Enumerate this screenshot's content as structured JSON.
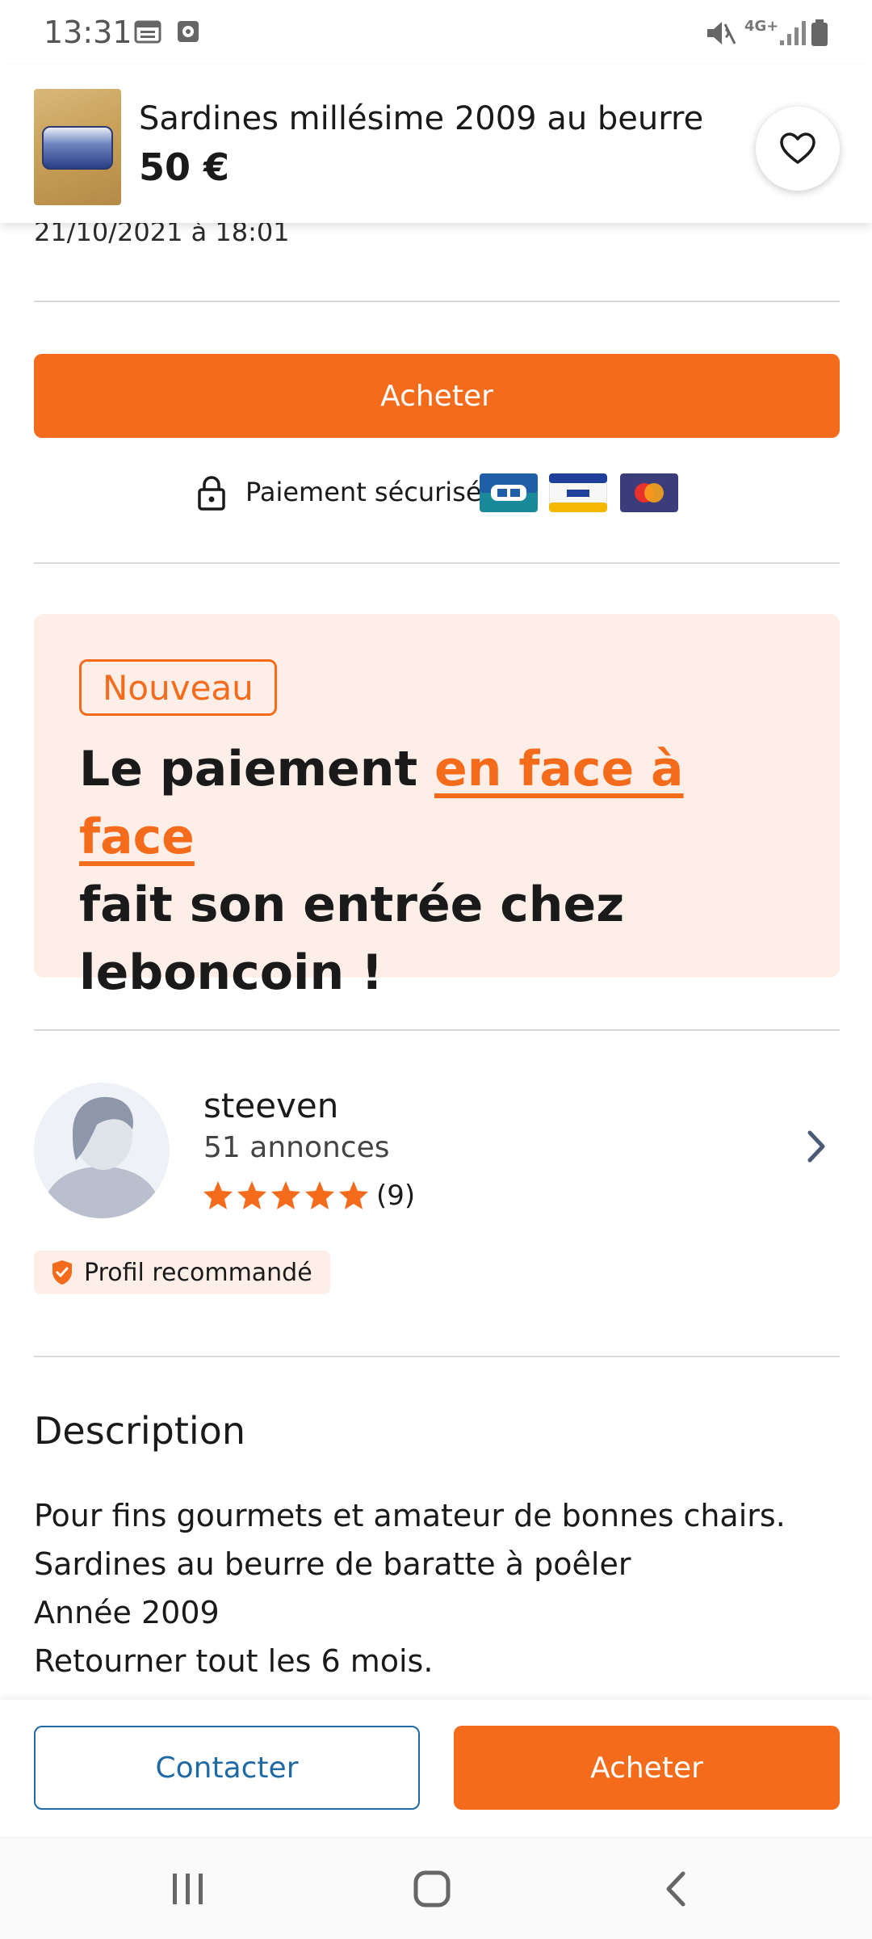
{
  "status_bar": {
    "time": "13:31",
    "network": "4G+"
  },
  "listing": {
    "title": "Sardines millésime 2009 au beurre",
    "price": "50 €",
    "date": "21/10/2021 à 18:01"
  },
  "actions": {
    "buy_label": "Acheter",
    "secure_payment": "Paiement sécurisé",
    "contact_label": "Contacter",
    "buy_bottom_label": "Acheter"
  },
  "payment_cards": [
    "cb-card-icon",
    "visa-card-icon",
    "mastercard-card-icon"
  ],
  "promo": {
    "badge": "Nouveau",
    "headline_prefix": "Le paiement ",
    "headline_highlight": "en face à face",
    "headline_line2": "fait son entrée chez",
    "headline_line3": "leboncoin !"
  },
  "seller": {
    "name": "steeven",
    "ads_count": "51 annonces",
    "rating": 5,
    "reviews": "(9)",
    "badge": "Profil recommandé"
  },
  "description": {
    "title": "Description",
    "lines": [
      "Pour fins gourmets et amateur de bonnes chairs.",
      "Sardines au beurre de baratte à poêler",
      "Année 2009",
      "Retourner tout les 6 mois."
    ]
  },
  "colors": {
    "accent": "#f56b1c",
    "promo_bg": "#fdeee7",
    "link_blue": "#1f6aa5"
  }
}
